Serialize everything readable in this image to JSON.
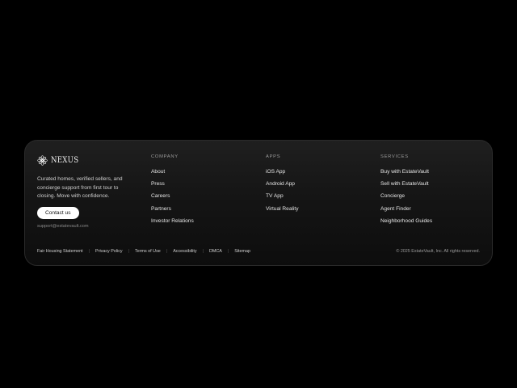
{
  "brand": {
    "name": "NEXUS",
    "tagline": "Curated homes, verified sellers, and concierge support from first tour to closing. Move with confidence.",
    "contact_label": "Contact us",
    "email": "support@estatevault.com"
  },
  "columns": [
    {
      "heading": "COMPANY",
      "links": [
        "About",
        "Press",
        "Careers",
        "Partners",
        "Investor Relations"
      ]
    },
    {
      "heading": "APPS",
      "links": [
        "iOS App",
        "Android App",
        "TV App",
        "Virtual Reality"
      ]
    },
    {
      "heading": "SERVICES",
      "links": [
        "Buy with EstateVault",
        "Sell with EstateVault",
        "Concierge",
        "Agent Finder",
        "Neighborhood Guides"
      ]
    }
  ],
  "legal_links": [
    "Fair Housing Statement",
    "Privacy Policy",
    "Terms of Use",
    "Accessibility",
    "DMCA",
    "Sitemap"
  ],
  "copyright": "© 2025 EstateVault, Inc. All rights reserved.",
  "icons": {
    "logo": "nexus-flower-logo-icon"
  },
  "colors": {
    "background": "#000000",
    "card": "#161616",
    "button": "#ffffff"
  }
}
